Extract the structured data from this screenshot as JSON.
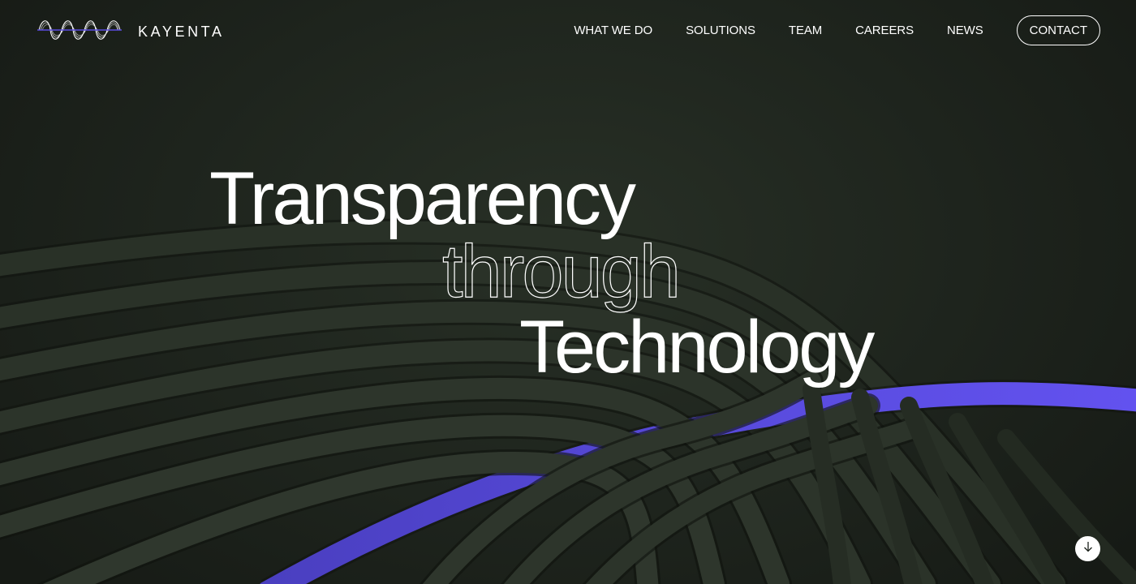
{
  "brand": {
    "name": "KAYENTA",
    "logo_icon": "coil-wave-logo-icon"
  },
  "nav": {
    "items": [
      {
        "label": "WHAT WE DO"
      },
      {
        "label": "SOLUTIONS"
      },
      {
        "label": "TEAM"
      },
      {
        "label": "CAREERS"
      },
      {
        "label": "NEWS"
      }
    ],
    "contact_label": "CONTACT"
  },
  "hero": {
    "line1": "Transparency",
    "line2": "through",
    "line3": "Technology"
  },
  "scroll_button": {
    "icon": "arrow-down-icon"
  },
  "colors": {
    "background": "#1e241d",
    "tube": "#2b3329",
    "accent_tube": "#5848d8",
    "text": "#ffffff"
  }
}
